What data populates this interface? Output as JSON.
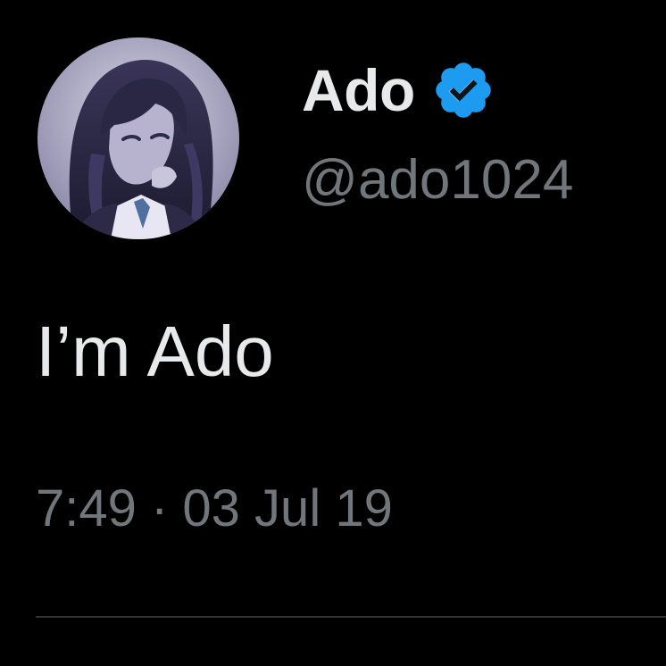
{
  "tweet": {
    "author": {
      "display_name": "Ado",
      "handle": "@ado1024",
      "verified": true,
      "verified_icon": "verified-badge-icon",
      "avatar": "profile-avatar"
    },
    "text": "I’m Ado",
    "timestamp": "7:49 · 03 Jul 19"
  },
  "colors": {
    "background": "#000000",
    "primary_text": "#e7e9ea",
    "secondary_text": "#71767b",
    "verified_blue": "#1d9bf0",
    "divider": "#2f3336"
  }
}
